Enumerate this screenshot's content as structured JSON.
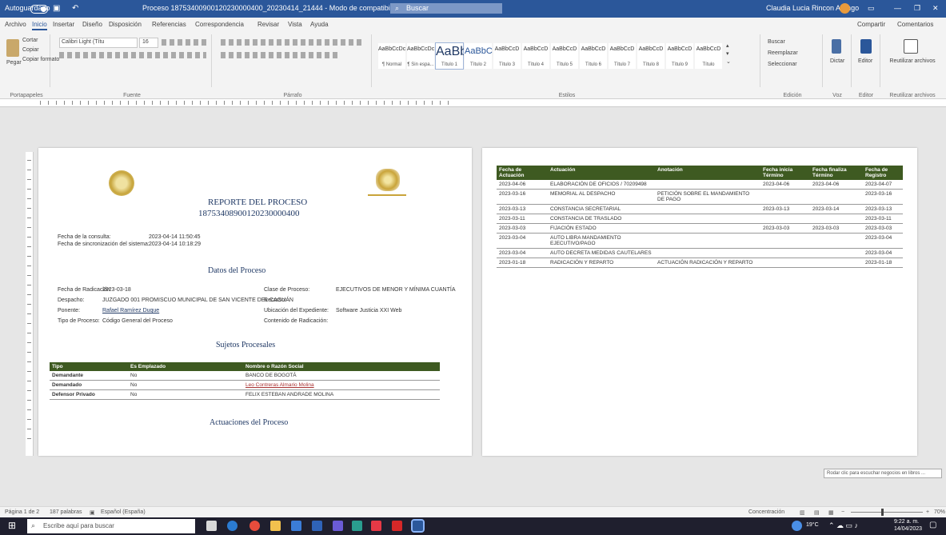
{
  "window": {
    "autosave_label": "Autoguardado",
    "autosave_state": "on",
    "doc_title": "Proceso 18753400900120230000400_20230414_21444 - Modo de compatibilidad - Word",
    "search_placeholder": "Buscar",
    "user_name": "Claudia Lucia Rincon Arango",
    "minimize": "—",
    "restore": "❐",
    "close": "✕"
  },
  "menu": {
    "items": [
      "Archivo",
      "Inicio",
      "Insertar",
      "Diseño",
      "Disposición",
      "Referencias",
      "Correspondencia",
      "Revisar",
      "Vista",
      "Ayuda"
    ],
    "share": "Compartir",
    "comments": "Comentarios"
  },
  "ribbon": {
    "clipboard": {
      "paste": "Pegar",
      "cut": "Cortar",
      "copy": "Copiar",
      "format_painter": "Copiar formato",
      "group": "Portapapeles"
    },
    "font": {
      "name": "Calibri Light (Títu",
      "size": "16",
      "group": "Fuente"
    },
    "paragraph": {
      "group": "Párrafo"
    },
    "styles": {
      "group": "Estilos",
      "items": [
        {
          "sample": "AaBbCcDc",
          "name": "¶ Normal"
        },
        {
          "sample": "AaBbCcDc",
          "name": "¶ Sin espa..."
        },
        {
          "sample": "AaBb",
          "name": "Título 1"
        },
        {
          "sample": "AaBbC",
          "name": "Título 2"
        },
        {
          "sample": "AaBbCcD",
          "name": "Título 3"
        },
        {
          "sample": "AaBbCcD",
          "name": "Título 4"
        },
        {
          "sample": "AaBbCcD",
          "name": "Título 5"
        },
        {
          "sample": "AaBbCcD",
          "name": "Título 6"
        },
        {
          "sample": "AaBbCcD",
          "name": "Título 7"
        },
        {
          "sample": "AaBbCcD",
          "name": "Título 8"
        },
        {
          "sample": "AaBbCcD",
          "name": "Título 9"
        },
        {
          "sample": "AaBbCcD",
          "name": "Título"
        }
      ]
    },
    "editing": {
      "find": "Buscar",
      "replace": "Reemplazar",
      "select": "Seleccionar",
      "group": "Edición"
    },
    "voice": {
      "label": "Dictar",
      "group": "Voz"
    },
    "editor": {
      "label": "Editor",
      "group": "Editor"
    },
    "reuse": {
      "label": "Reutilizar archivos",
      "group": "Reutilizar archivos"
    }
  },
  "page1": {
    "title": "REPORTE DEL PROCESO",
    "process_number": "18753408900120230000400",
    "query_date_label": "Fecha de la consulta:",
    "query_date_value": "2023-04-14 11:50:45",
    "sync_date_label": "Fecha de sincronización del sistema:",
    "sync_date_value": "2023-04-14 10:18:29",
    "section_data": "Datos del Proceso",
    "fields_left": [
      {
        "label": "Fecha de Radicación:",
        "value": "2023-03-18"
      },
      {
        "label": "Despacho:",
        "value": "JUZGADO 001 PROMISCUO MUNICIPAL DE SAN VICENTE DEL CAGUÁN"
      },
      {
        "label": "Ponente:",
        "value": "Rafael Ramírez Duque"
      },
      {
        "label": "Tipo de Proceso:",
        "value": "Código General del Proceso"
      }
    ],
    "fields_right": [
      {
        "label": "Clase de Proceso:",
        "value": "EJECUTIVOS DE MENOR Y MÍNIMA CUANTÍA"
      },
      {
        "label": "Recurso:",
        "value": ""
      },
      {
        "label": "Ubicación del Expediente:",
        "value": "Software Justicia XXI Web"
      },
      {
        "label": "Contenido de Radicación:",
        "value": ""
      }
    ],
    "section_parties": "Sujetos Procesales",
    "parties_headers": [
      "Tipo",
      "Es Emplazado",
      "Nombre o Razón Social"
    ],
    "parties_rows": [
      [
        "Demandante",
        "No",
        "BANCO DE BOGOTÁ"
      ],
      [
        "Demandado",
        "No",
        "Leo Contreras Almario Molina"
      ],
      [
        "Defensor Privado",
        "No",
        "FELIX ESTEBAN ANDRADE MOLINA"
      ]
    ],
    "section_actions": "Actuaciones del Proceso"
  },
  "page2": {
    "headers": [
      "Fecha de Actuación",
      "Actuación",
      "Anotación",
      "Fecha inicia Término",
      "Fecha finaliza Término",
      "Fecha de Registro"
    ],
    "rows": [
      [
        "2023-04-06",
        "ELABORACIÓN DE OFICIOS / 70209498",
        "",
        "2023-04-06",
        "2023-04-06",
        "2023-04-07"
      ],
      [
        "2023-03-16",
        "MEMORIAL AL DESPACHO",
        "PETICIÓN SOBRE EL MANDAMIENTO DE PAGO",
        "",
        "",
        "2023-03-16"
      ],
      [
        "2023-03-13",
        "CONSTANCIA SECRETARIAL",
        "",
        "2023-03-13",
        "2023-03-14",
        "2023-03-13"
      ],
      [
        "2023-03-11",
        "CONSTANCIA DE TRASLADO",
        "",
        "",
        "",
        "2023-03-11"
      ],
      [
        "2023-03-03",
        "FIJACIÓN ESTADO",
        "",
        "2023-03-03",
        "2023-03-03",
        "2023-03-03"
      ],
      [
        "2023-03-04",
        "AUTO LIBRA MANDAMIENTO EJECUTIVO/PAGO",
        "",
        "",
        "",
        "2023-03-04"
      ],
      [
        "2023-03-04",
        "AUTO DECRETA MEDIDAS CAUTELARES",
        "",
        "",
        "",
        "2023-03-04"
      ],
      [
        "2023-01-18",
        "RADICACIÓN Y REPARTO",
        "ACTUACIÓN RADICACIÓN Y REPARTO",
        "",
        "",
        "2023-01-18"
      ]
    ]
  },
  "tooltip": "Rodar clic para escuchar negocios en libros ...",
  "status": {
    "page": "Página 1 de 2",
    "words": "187 palabras",
    "language": "Español (España)",
    "focus": "Concentración",
    "zoom": "70%"
  },
  "taskbar": {
    "search_placeholder": "Escribe aquí para buscar",
    "temp": "19°C",
    "time": "9:22 a. m.",
    "date": "14/04/2023"
  }
}
